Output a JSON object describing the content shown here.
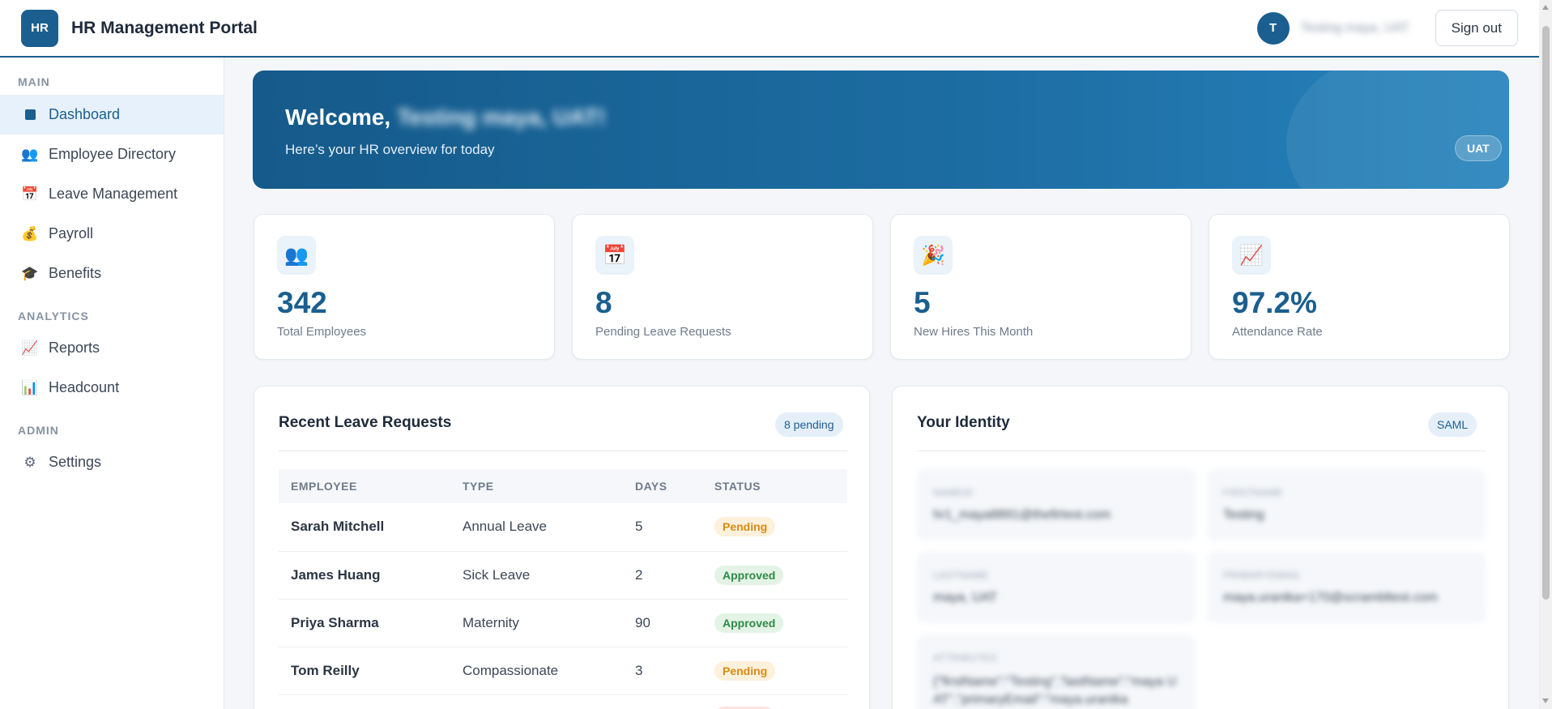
{
  "header": {
    "logo_text": "HR",
    "title": "HR Management Portal",
    "avatar_initial": "T",
    "user_name": "Testing maya, UAT",
    "sign_out_label": "Sign out"
  },
  "sidebar": {
    "sections": [
      {
        "title": "MAIN",
        "items": [
          {
            "label": "Dashboard",
            "icon": "square-icon",
            "active": true
          },
          {
            "label": "Employee Directory",
            "icon": "people-icon"
          },
          {
            "label": "Leave Management",
            "icon": "calendar-icon"
          },
          {
            "label": "Payroll",
            "icon": "money-bag-icon"
          },
          {
            "label": "Benefits",
            "icon": "graduation-cap-icon"
          }
        ]
      },
      {
        "title": "ANALYTICS",
        "items": [
          {
            "label": "Reports",
            "icon": "chart-up-icon"
          },
          {
            "label": "Headcount",
            "icon": "bar-chart-icon"
          }
        ]
      },
      {
        "title": "ADMIN",
        "items": [
          {
            "label": "Settings",
            "icon": "gear-icon"
          }
        ]
      }
    ]
  },
  "banner": {
    "welcome": "Welcome,",
    "user_name": "Testing maya, UAT!",
    "subtitle": "Here’s your HR overview for today",
    "env_badge": "UAT"
  },
  "stats": [
    {
      "value": "342",
      "label": "Total Employees",
      "icon": "people-icon"
    },
    {
      "value": "8",
      "label": "Pending Leave Requests",
      "icon": "calendar-icon"
    },
    {
      "value": "5",
      "label": "New Hires This Month",
      "icon": "party-popper-icon"
    },
    {
      "value": "97.2%",
      "label": "Attendance Rate",
      "icon": "chart-up-icon"
    }
  ],
  "leave_requests": {
    "title": "Recent Leave Requests",
    "badge": "8 pending",
    "columns": [
      "EMPLOYEE",
      "TYPE",
      "DAYS",
      "STATUS"
    ],
    "rows": [
      {
        "employee": "Sarah Mitchell",
        "type": "Annual Leave",
        "days": "5",
        "status": "Pending",
        "status_kind": "pending"
      },
      {
        "employee": "James Huang",
        "type": "Sick Leave",
        "days": "2",
        "status": "Approved",
        "status_kind": "approved"
      },
      {
        "employee": "Priya Sharma",
        "type": "Maternity",
        "days": "90",
        "status": "Approved",
        "status_kind": "approved"
      },
      {
        "employee": "Tom Reilly",
        "type": "Compassionate",
        "days": "3",
        "status": "Pending",
        "status_kind": "pending"
      },
      {
        "employee": "",
        "type": "",
        "days": "",
        "status": "",
        "status_kind": "rejected"
      }
    ]
  },
  "identity": {
    "title": "Your Identity",
    "badge": "SAML",
    "fields": [
      {
        "label": "NAMEID",
        "value": "hr1_maya8891@thefirtest.com"
      },
      {
        "label": "FIRSTNAME",
        "value": "Testing"
      },
      {
        "label": "LASTNAME",
        "value": "maya, UAT"
      },
      {
        "label": "PRIMARYEMAIL",
        "value": "maya.uranika+170@scrambltest.com"
      },
      {
        "label": "ATTRIBUTES",
        "value": "{\"firstName\":\"Testing\",\"lastName\":\"maya UAT\",\"primaryEmail\":\"maya.uranika"
      }
    ]
  },
  "colors": {
    "brand": "#1a5f8f",
    "pending": "#d98a14",
    "approved": "#2f8a47"
  }
}
